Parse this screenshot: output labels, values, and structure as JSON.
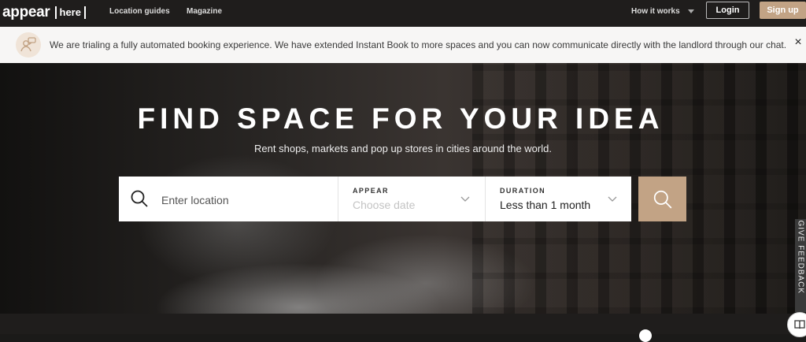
{
  "nav": {
    "logo_word": "appear",
    "logo_bracket": "here",
    "location_guides": "Location guides",
    "magazine": "Magazine",
    "how_it_works": "How it works",
    "login": "Login",
    "signup": "Sign up"
  },
  "banner": {
    "message": "We are trialing a fully automated booking experience. We have extended Instant Book to more spaces and you can now communicate directly with the landlord through our chat.",
    "close": "×"
  },
  "hero": {
    "title": "FIND SPACE FOR YOUR IDEA",
    "subtitle": "Rent shops, markets and pop up stores in cities around the world."
  },
  "search": {
    "location_placeholder": "Enter location",
    "appear_label": "APPEAR",
    "appear_placeholder": "Choose date",
    "duration_label": "DURATION",
    "duration_value": "Less than 1 month"
  },
  "feedback": {
    "label": "GIVE FEEDBACK"
  },
  "colors": {
    "accent": "#c2a385",
    "nav_bg": "#1f1d1c"
  }
}
